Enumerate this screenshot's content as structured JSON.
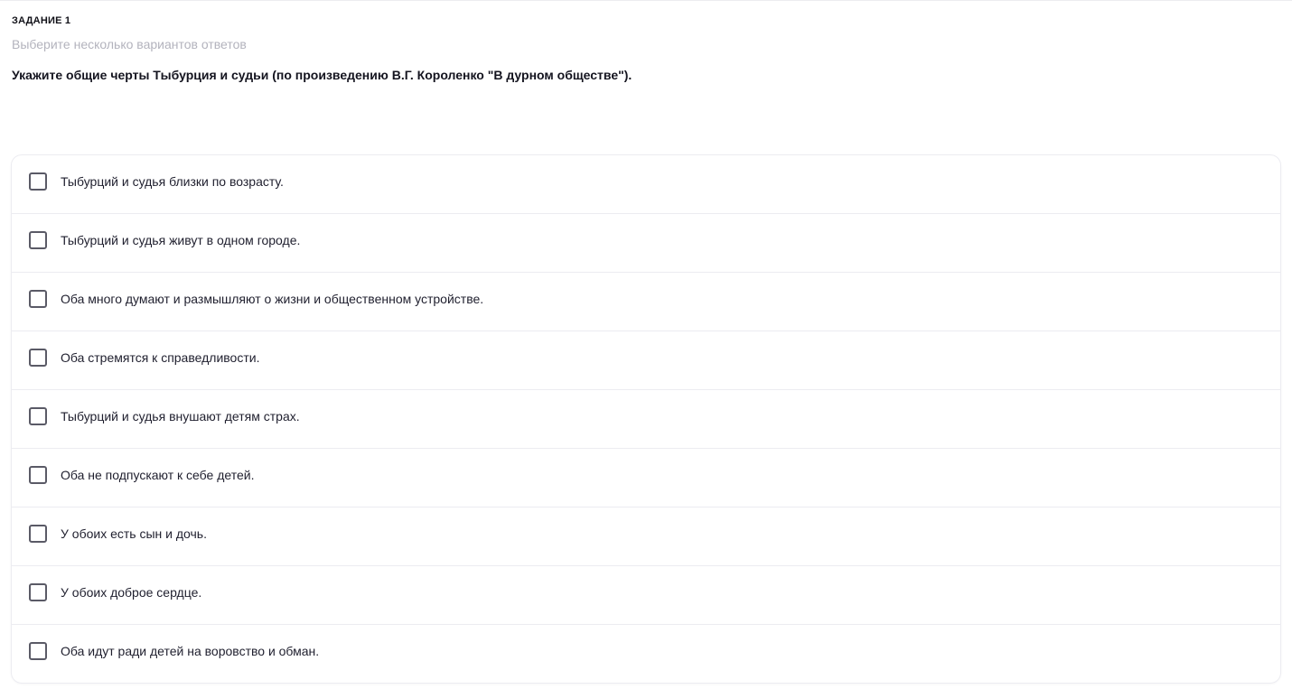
{
  "task": {
    "label": "ЗАДАНИЕ 1",
    "hint": "Выберите несколько вариантов ответов",
    "question": "Укажите общие черты Тыбурция и судьи (по произведению В.Г. Короленко \"В дурном обществе\")."
  },
  "options": [
    {
      "label": "Тыбурций и судья близки по возрасту.",
      "checked": false
    },
    {
      "label": "Тыбурций и судья живут в одном городе.",
      "checked": false
    },
    {
      "label": "Оба много думают и размышляют о жизни и общественном устройстве.",
      "checked": false
    },
    {
      "label": "Оба стремятся к справедливости.",
      "checked": false
    },
    {
      "label": "Тыбурций и судья внушают детям страх.",
      "checked": false
    },
    {
      "label": "Оба не подпускают к себе детей.",
      "checked": false
    },
    {
      "label": "У обоих есть сын и дочь.",
      "checked": false
    },
    {
      "label": "У обоих доброе сердце.",
      "checked": false
    },
    {
      "label": "Оба идут ради детей на воровство и обман.",
      "checked": false
    }
  ]
}
